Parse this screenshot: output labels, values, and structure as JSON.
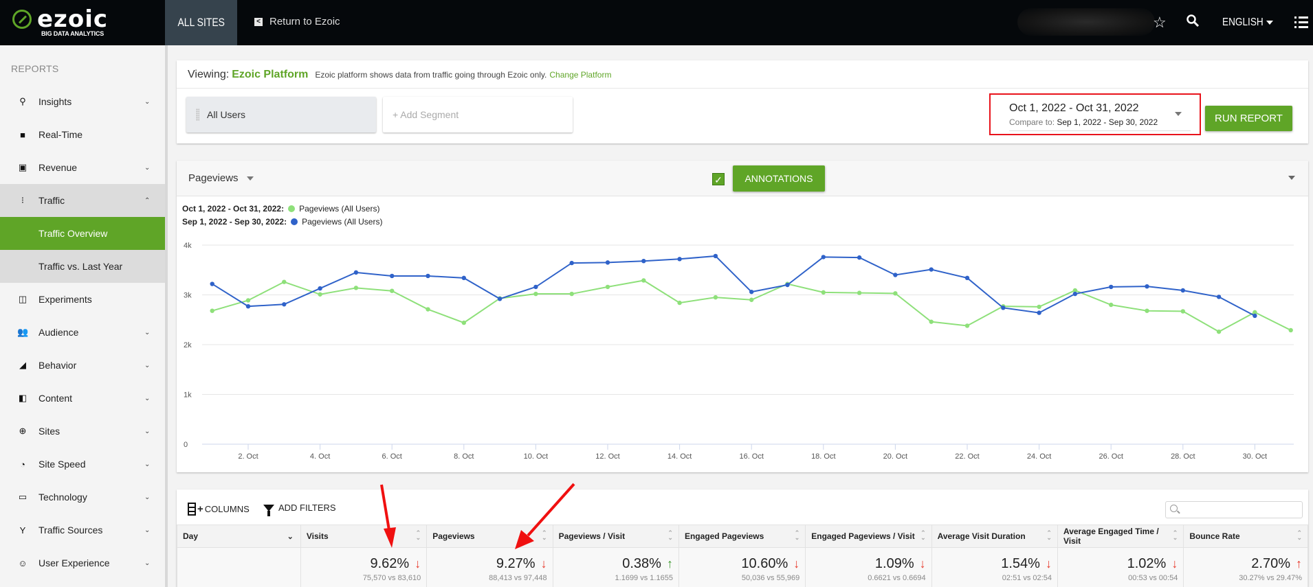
{
  "topbar": {
    "logo_word": "ezoic",
    "logo_sub": "BIG DATA ANALYTICS",
    "all_sites": "ALL SITES",
    "return_label": "Return to Ezoic",
    "language": "ENGLISH",
    "icons": {
      "star": "☆",
      "search": "⚲",
      "back": "<"
    }
  },
  "sidebar": {
    "section": "REPORTS",
    "items": [
      {
        "label": "Insights",
        "icon": "⚲",
        "chevron": "⌄",
        "state": ""
      },
      {
        "label": "Real-Time",
        "icon": "■",
        "chevron": "",
        "state": ""
      },
      {
        "label": "Revenue",
        "icon": "▣",
        "chevron": "⌄",
        "state": ""
      },
      {
        "label": "Traffic",
        "icon": "⁝",
        "chevron": "⌃",
        "state": "open"
      },
      {
        "label": "Traffic Overview",
        "icon": "",
        "chevron": "",
        "state": "active"
      },
      {
        "label": "Traffic vs. Last Year",
        "icon": "",
        "chevron": "",
        "state": "sub"
      },
      {
        "label": "Experiments",
        "icon": "◫",
        "chevron": "",
        "state": ""
      },
      {
        "label": "Audience",
        "icon": "👥",
        "chevron": "⌄",
        "state": ""
      },
      {
        "label": "Behavior",
        "icon": "◢",
        "chevron": "⌄",
        "state": ""
      },
      {
        "label": "Content",
        "icon": "◧",
        "chevron": "⌄",
        "state": ""
      },
      {
        "label": "Sites",
        "icon": "⊕",
        "chevron": "⌄",
        "state": ""
      },
      {
        "label": "Site Speed",
        "icon": "◔",
        "chevron": "⌄",
        "state": ""
      },
      {
        "label": "Technology",
        "icon": "▭",
        "chevron": "⌄",
        "state": ""
      },
      {
        "label": "Traffic Sources",
        "icon": "Y",
        "chevron": "⌄",
        "state": ""
      },
      {
        "label": "User Experience",
        "icon": "☺",
        "chevron": "⌄",
        "state": ""
      }
    ]
  },
  "filters": {
    "viewing_label": "Viewing:",
    "platform": "Ezoic Platform",
    "platform_note": "Ezoic platform shows data from traffic going through Ezoic only.",
    "change_platform": "Change Platform",
    "segment": "All Users",
    "add_segment": "+ Add Segment",
    "date_range": "Oct 1, 2022 - Oct 31, 2022",
    "compare_label": "Compare to:",
    "compare_range": "Sep 1, 2022 - Sep 30, 2022",
    "run_report": "RUN REPORT"
  },
  "chart_panel": {
    "metric": "Pageviews",
    "annotations_checked": true,
    "annotations_label": "ANNOTATIONS",
    "check_glyph": "✓"
  },
  "chart_data": {
    "type": "line",
    "title": "",
    "xlabel": "",
    "ylabel": "",
    "ylim": [
      0,
      4000
    ],
    "grid": true,
    "legend_position": "top-left",
    "y_ticks": [
      "0",
      "1k",
      "2k",
      "3k",
      "4k"
    ],
    "x_tick_labels": [
      "2. Oct",
      "4. Oct",
      "6. Oct",
      "8. Oct",
      "10. Oct",
      "12. Oct",
      "14. Oct",
      "16. Oct",
      "18. Oct",
      "20. Oct",
      "22. Oct",
      "24. Oct",
      "26. Oct",
      "28. Oct",
      "30. Oct"
    ],
    "x": [
      1,
      2,
      3,
      4,
      5,
      6,
      7,
      8,
      9,
      10,
      11,
      12,
      13,
      14,
      15,
      16,
      17,
      18,
      19,
      20,
      21,
      22,
      23,
      24,
      25,
      26,
      27,
      28,
      29,
      30,
      31
    ],
    "series": [
      {
        "range": "Oct 1, 2022 - Oct 31, 2022:",
        "name": "Pageviews (All Users)",
        "color": "#8ee07a",
        "values": [
          2680,
          2890,
          3260,
          3010,
          3140,
          3080,
          2710,
          2440,
          2930,
          3020,
          3020,
          3160,
          3290,
          2840,
          2950,
          2900,
          3220,
          3050,
          3040,
          3030,
          2460,
          2380,
          2770,
          2760,
          3090,
          2800,
          2680,
          2670,
          2260,
          2650,
          2290
        ]
      },
      {
        "range": "Sep 1, 2022 - Sep 30, 2022:",
        "name": "Pageviews (All Users)",
        "color": "#2f62c9",
        "values": [
          3220,
          2770,
          2810,
          3130,
          3450,
          3380,
          3380,
          3340,
          2920,
          3160,
          3640,
          3650,
          3680,
          3720,
          3780,
          3060,
          3200,
          3760,
          3750,
          3400,
          3510,
          3340,
          2740,
          2640,
          3020,
          3160,
          3170,
          3090,
          2960,
          2580
        ]
      }
    ]
  },
  "table": {
    "columns_label": "COLUMNS",
    "filters_label": "ADD FILTERS",
    "search_placeholder": "",
    "headers": [
      "Day",
      "Visits",
      "Pageviews",
      "Pageviews / Visit",
      "Engaged Pageviews",
      "Engaged Pageviews / Visit",
      "Average Visit Duration",
      "Average Engaged Time / Visit",
      "Bounce Rate"
    ],
    "summary": [
      {
        "pct": "",
        "arrow": "",
        "trend": "",
        "cmp": ""
      },
      {
        "pct": "9.62%",
        "arrow": "🡓",
        "trend": "down-bad",
        "cmp": "75,570 vs 83,610"
      },
      {
        "pct": "9.27%",
        "arrow": "🡓",
        "trend": "down-bad",
        "cmp": "88,413 vs 97,448"
      },
      {
        "pct": "0.38%",
        "arrow": "🡑",
        "trend": "up-good",
        "cmp": "1.1699 vs 1.1655"
      },
      {
        "pct": "10.60%",
        "arrow": "🡓",
        "trend": "down-bad",
        "cmp": "50,036 vs 55,969"
      },
      {
        "pct": "1.09%",
        "arrow": "🡓",
        "trend": "down-bad",
        "cmp": "0.6621 vs 0.6694"
      },
      {
        "pct": "1.54%",
        "arrow": "🡓",
        "trend": "down-bad",
        "cmp": "02:51 vs 02:54"
      },
      {
        "pct": "1.02%",
        "arrow": "🡓",
        "trend": "down-bad",
        "cmp": "00:53 vs 00:54"
      },
      {
        "pct": "2.70%",
        "arrow": "🡑",
        "trend": "up-bad",
        "cmp": "30.27% vs 29.47%"
      }
    ]
  },
  "colors": {
    "brand_green": "#5fa527",
    "topbar": "#05080b",
    "bad": "#e8392b",
    "good": "#3e9a2e",
    "highlight_red": "#e8121b"
  }
}
